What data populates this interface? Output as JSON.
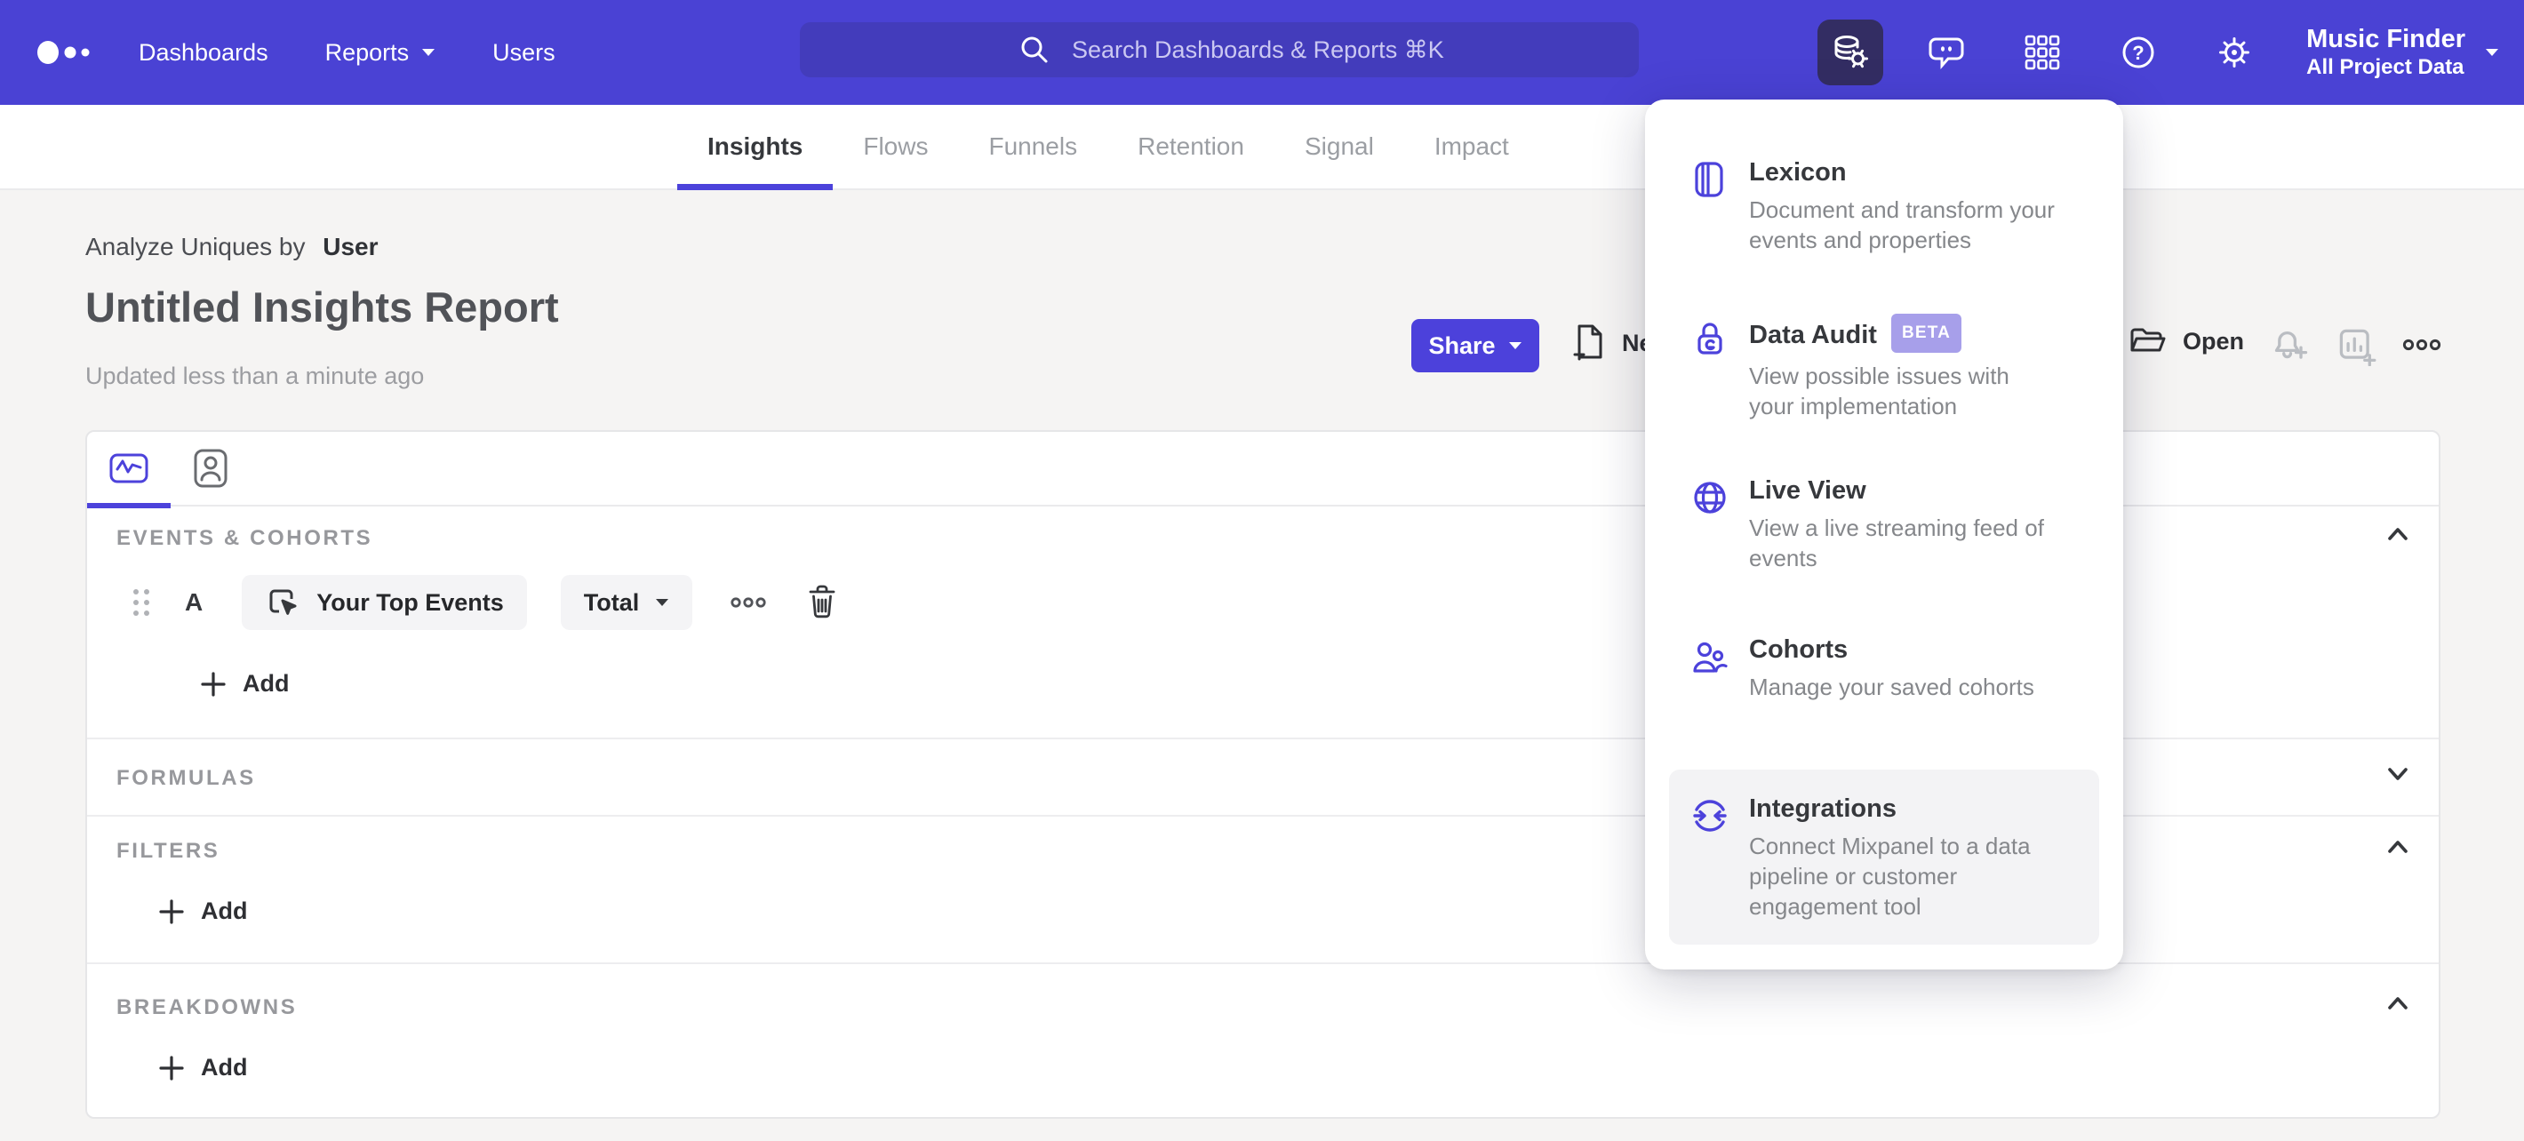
{
  "topnav": {
    "brand_icon": "mixpanel-logo",
    "items": [
      "Dashboards",
      "Reports",
      "Users"
    ],
    "search": {
      "placeholder": "Search Dashboards & Reports ⌘K",
      "icon": "search-icon"
    },
    "icon_buttons": [
      {
        "icon": "data-management-icon",
        "active": true
      },
      {
        "icon": "feedback-bubble-icon",
        "active": false
      },
      {
        "icon": "apps-grid-icon",
        "active": false
      },
      {
        "icon": "help-icon",
        "active": false
      },
      {
        "icon": "settings-gear-icon",
        "active": false
      }
    ],
    "project": {
      "name": "Music Finder",
      "scope": "All Project Data",
      "icon": "chevron-down-icon"
    }
  },
  "tabs": {
    "items": [
      "Insights",
      "Flows",
      "Funnels",
      "Retention",
      "Signal",
      "Impact"
    ],
    "active": "Insights"
  },
  "header": {
    "analyze_label": "Analyze Uniques by",
    "analyze_value": "User",
    "title": "Untitled Insights Report",
    "updated": "Updated less than a minute ago",
    "share": "Share",
    "new": "New",
    "open": "Open"
  },
  "builder": {
    "events": {
      "label": "EVENTS & COHORTS",
      "row_letter": "A",
      "event_name": "Your Top Events",
      "metric": "Total",
      "add": "Add"
    },
    "formulas": {
      "label": "FORMULAS"
    },
    "filters": {
      "label": "FILTERS",
      "add": "Add"
    },
    "breakdowns": {
      "label": "BREAKDOWNS",
      "add": "Add"
    }
  },
  "data_menu": {
    "highlighted": "Integrations",
    "items": [
      {
        "icon": "book-icon",
        "title": "Lexicon",
        "desc": "Document and transform your events and properties"
      },
      {
        "icon": "lock-icon",
        "title": "Data Audit",
        "badge": "BETA",
        "desc": "View possible issues with your implementation"
      },
      {
        "icon": "globe-icon",
        "title": "Live View",
        "desc": "View a live streaming feed of events"
      },
      {
        "icon": "people-icon",
        "title": "Cohorts",
        "desc": "Manage your saved cohorts"
      },
      {
        "icon": "sync-icon",
        "title": "Integrations",
        "desc": "Connect Mixpanel to a data pipeline or customer engagement tool"
      }
    ]
  },
  "colors": {
    "nav_bg": "#4A42D4",
    "search_bg": "#433CBB",
    "active_icon_bg": "#332D63",
    "accent": "#4C42DB",
    "beta_badge_bg": "#A79FEA",
    "page_bg": "#F5F4F3",
    "card_border": "#E6E6E8",
    "muted_text": "#97989C"
  }
}
